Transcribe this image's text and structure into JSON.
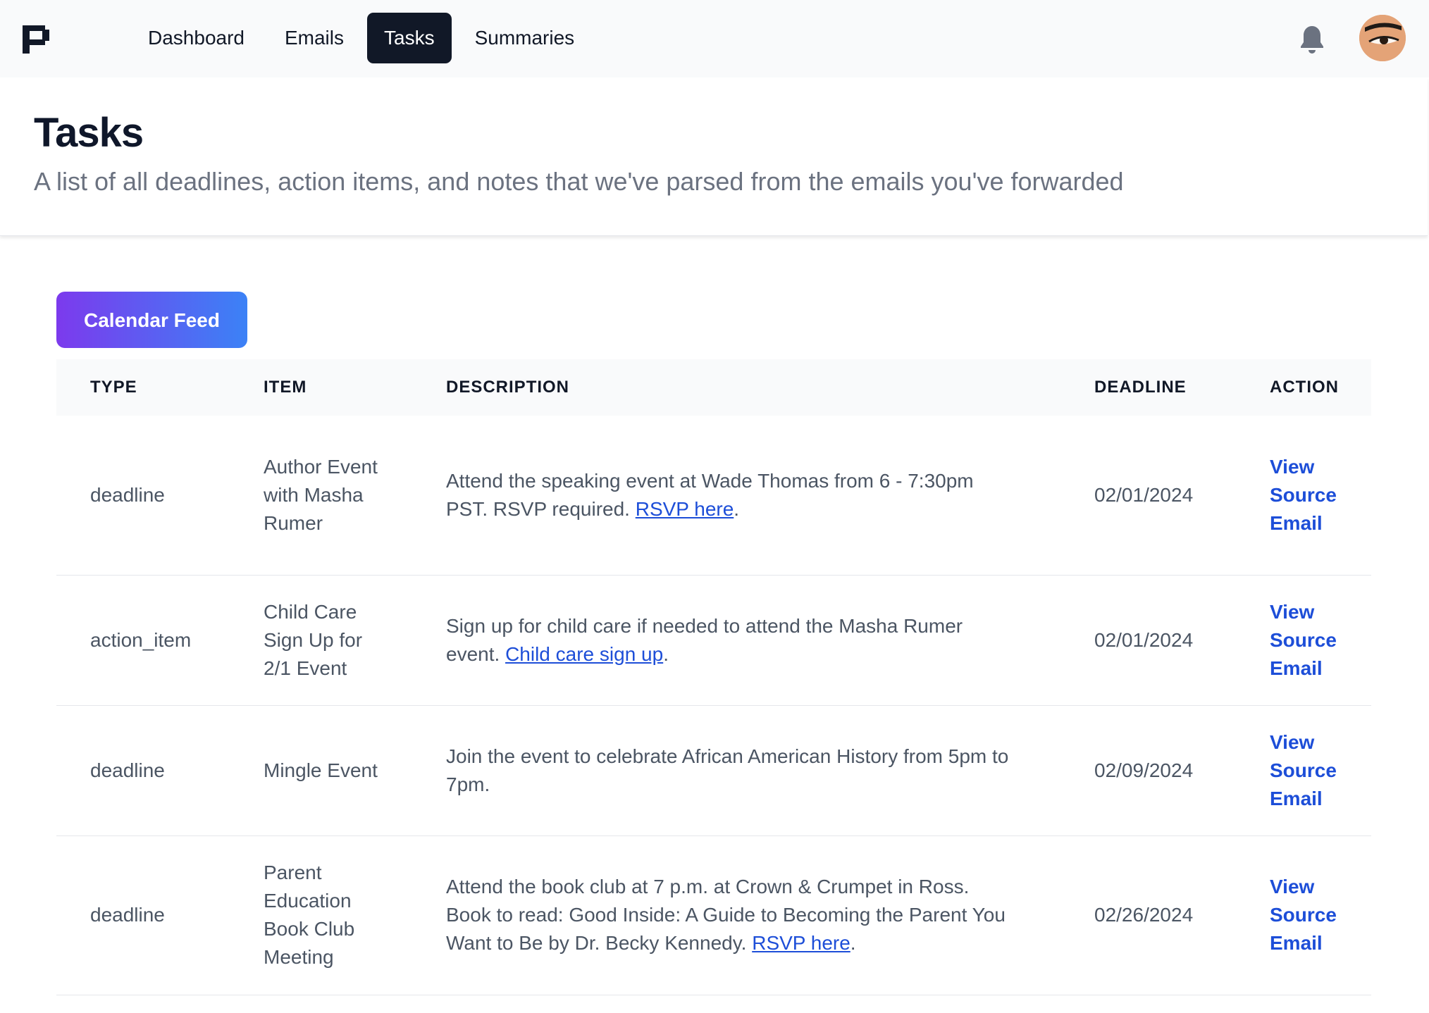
{
  "nav": {
    "links": [
      "Dashboard",
      "Emails",
      "Tasks",
      "Summaries"
    ],
    "active": "Tasks"
  },
  "header": {
    "title": "Tasks",
    "subtitle": "A list of all deadlines, action items, and notes that we've parsed from the emails you've forwarded"
  },
  "calendar_button": "Calendar Feed",
  "table": {
    "columns": [
      "TYPE",
      "ITEM",
      "DESCRIPTION",
      "DEADLINE",
      "ACTION"
    ],
    "rows": [
      {
        "type": "deadline",
        "item": "Author Event with Masha Rumer",
        "description": "Attend the speaking event at Wade Thomas from 6 - 7:30pm PST. RSVP required.",
        "link_text": "RSVP here",
        "deadline": "02/01/2024",
        "action": "View Source Email"
      },
      {
        "type": "action_item",
        "item": "Child Care Sign Up for 2/1 Event",
        "description": "Sign up for child care if needed to attend the Masha Rumer event.",
        "link_text": "Child care sign up",
        "deadline": "02/01/2024",
        "action": "View Source Email"
      },
      {
        "type": "deadline",
        "item": "Mingle Event",
        "description": "Join the event to celebrate African American History from 5pm to 7pm.",
        "link_text": "",
        "deadline": "02/09/2024",
        "action": "View Source Email"
      },
      {
        "type": "deadline",
        "item": "Parent Education Book Club Meeting",
        "description": "Attend the book club at 7 p.m. at Crown & Crumpet in Ross. Book to read: Good Inside: A Guide to Becoming the Parent You Want to Be by Dr. Becky Kennedy.",
        "link_text": "RSVP here",
        "deadline": "02/26/2024",
        "action": "View Source Email"
      }
    ]
  },
  "colors": {
    "nav_bg": "#f9fafb",
    "active_tab": "#111827",
    "link": "#1d4ed8",
    "button_gradient_start": "#7c3aed",
    "button_gradient_end": "#3b82f6"
  },
  "icons": [
    "app-logo-icon",
    "bell-icon"
  ]
}
